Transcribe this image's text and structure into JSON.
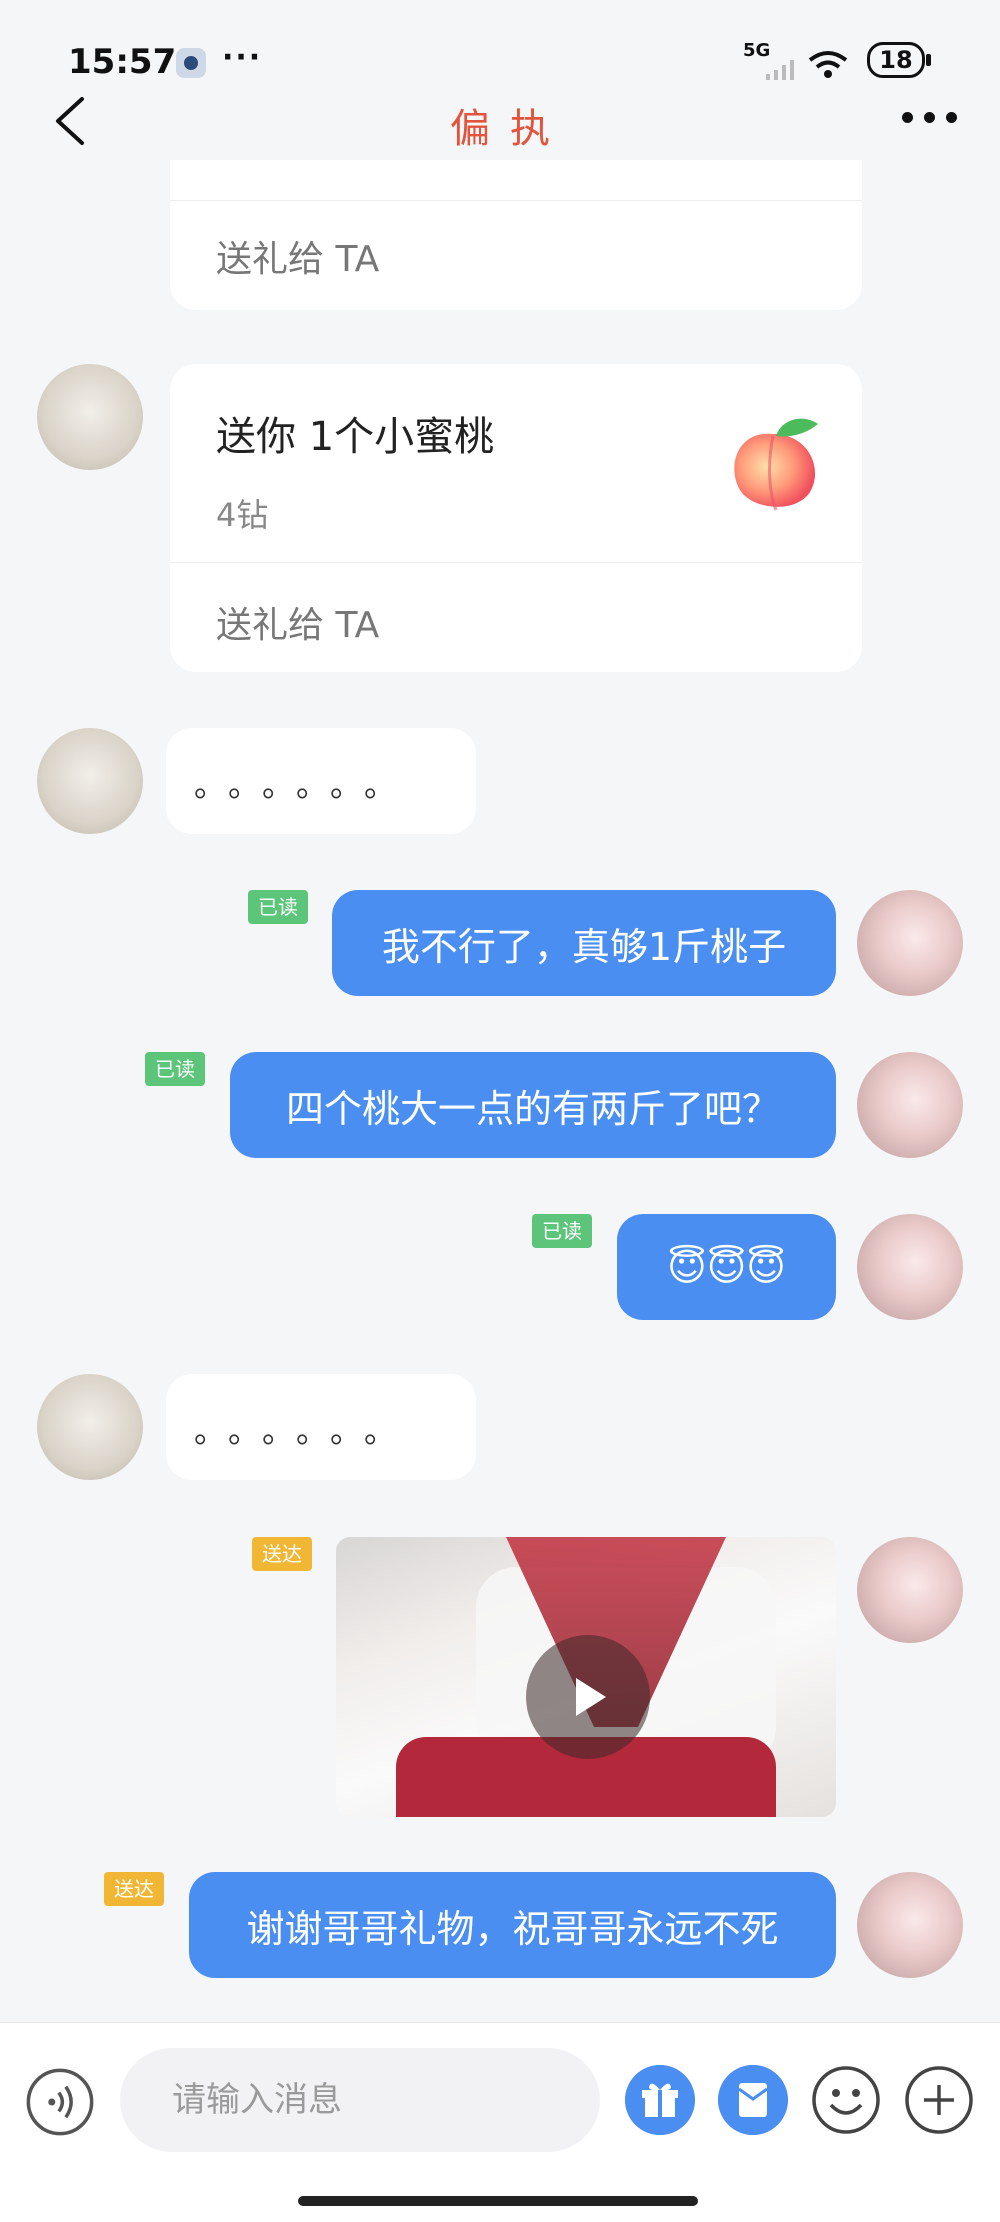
{
  "status_bar": {
    "time": "15:57",
    "more": "···",
    "network": "5G",
    "battery": "18"
  },
  "header": {
    "title": "偏执"
  },
  "messages": {
    "gift_partial": {
      "action": "送礼给 TA"
    },
    "gift_peach": {
      "title": "送你 1个小蜜桃",
      "price": "4钻",
      "action": "送礼给 TA"
    },
    "dots_1": {
      "text": "。。。。。。"
    },
    "out_1": {
      "status": "已读",
      "text": "我不行了，真够1斤桃子"
    },
    "out_2": {
      "status": "已读",
      "text": "四个桃大一点的有两斤了吧？"
    },
    "out_3": {
      "status": "已读",
      "text": "😇😇😇"
    },
    "dots_2": {
      "text": "。。。。。。"
    },
    "video": {
      "status": "送达"
    },
    "out_4": {
      "status": "送达",
      "text": "谢谢哥哥礼物，祝哥哥永远不死"
    }
  },
  "input": {
    "placeholder": "请输入消息"
  },
  "colors": {
    "accent_title": "#e2543b",
    "bubble_out": "#4a8ef1",
    "badge_read": "#5cc57a",
    "badge_sent": "#f2b635"
  },
  "icons": [
    "app-notification-icon",
    "signal-icon",
    "wifi-icon",
    "battery-icon",
    "back-arrow-icon",
    "more-icon",
    "peach-icon",
    "play-icon",
    "voice-icon",
    "gift-icon",
    "red-packet-icon",
    "emoji-icon",
    "plus-icon"
  ]
}
